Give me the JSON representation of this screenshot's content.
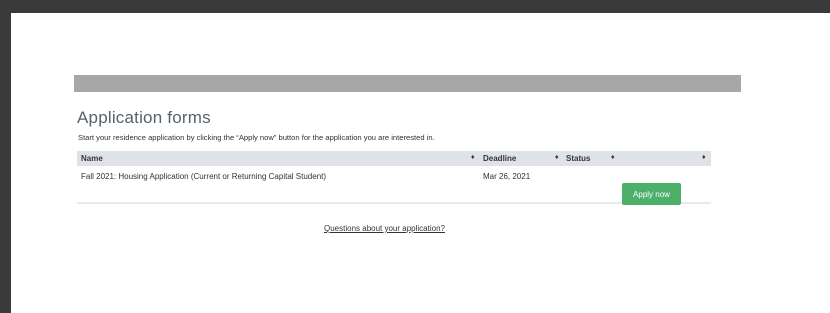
{
  "page": {
    "title": "Application forms",
    "subtitle": "Start your residence application by clicking the “Apply now” button for the application you are interested in."
  },
  "table": {
    "columns": [
      "Name",
      "Deadline",
      "Status",
      ""
    ],
    "sort_icon": "sort-icon",
    "rows": [
      {
        "name": "Fall 2021: Housing Application (Current or Returning Capital Student)",
        "deadline": "Mar 26, 2021",
        "status": "",
        "action_label": "Apply now"
      }
    ]
  },
  "questions_link": "Questions about your application?",
  "colors": {
    "banner": "#a5a7a9",
    "title": "#556270",
    "table_header": "#dfe3e8",
    "apply_button": "#4caf6a"
  }
}
